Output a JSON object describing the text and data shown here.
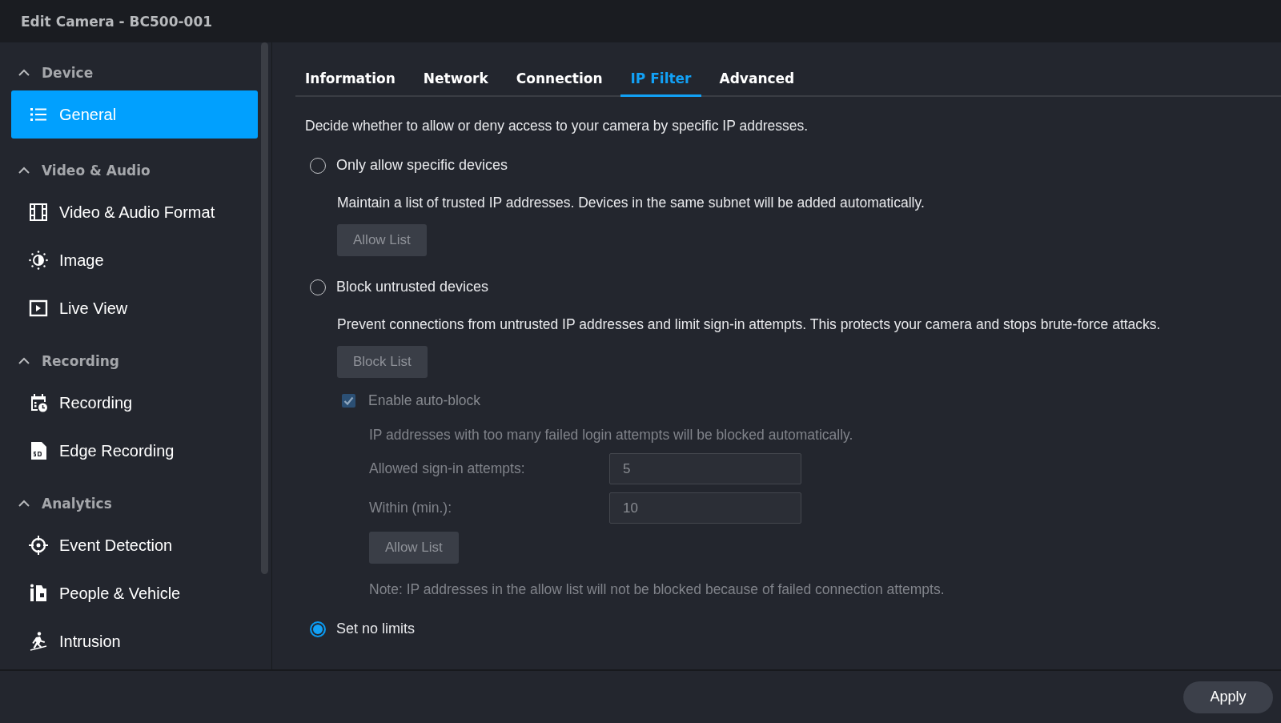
{
  "window": {
    "title": "Edit Camera - BC500-001"
  },
  "sidebar": {
    "groups": [
      {
        "label": "Device",
        "expanded": true,
        "items": [
          {
            "label": "General",
            "selected": true
          }
        ]
      },
      {
        "label": "Video & Audio",
        "expanded": true,
        "items": [
          {
            "label": "Video & Audio Format",
            "selected": false
          },
          {
            "label": "Image",
            "selected": false
          },
          {
            "label": "Live View",
            "selected": false
          }
        ]
      },
      {
        "label": "Recording",
        "expanded": true,
        "items": [
          {
            "label": "Recording",
            "selected": false
          },
          {
            "label": "Edge Recording",
            "selected": false
          }
        ]
      },
      {
        "label": "Analytics",
        "expanded": true,
        "items": [
          {
            "label": "Event Detection",
            "selected": false
          },
          {
            "label": "People & Vehicle",
            "selected": false
          },
          {
            "label": "Intrusion",
            "selected": false
          }
        ]
      }
    ]
  },
  "tabs": [
    {
      "label": "Information",
      "selected": false
    },
    {
      "label": "Network",
      "selected": false
    },
    {
      "label": "Connection",
      "selected": false
    },
    {
      "label": "IP Filter",
      "selected": true
    },
    {
      "label": "Advanced",
      "selected": false
    }
  ],
  "content": {
    "intro": "Decide whether to allow or deny access to your camera by specific IP addresses.",
    "options": [
      {
        "label": "Only allow specific devices",
        "selected": false,
        "description": "Maintain a list of trusted IP addresses. Devices in the same subnet will be added automatically.",
        "button": "Allow List"
      },
      {
        "label": "Block untrusted devices",
        "selected": false,
        "description": "Prevent connections from untrusted IP addresses and limit sign-in attempts. This protects your camera and stops brute-force attacks.",
        "button": "Block List",
        "auto_block": {
          "label": "Enable auto-block",
          "checked": true,
          "disabled": true,
          "description": "IP addresses with too many failed login attempts will be blocked automatically.",
          "fields": [
            {
              "label": "Allowed sign-in attempts:",
              "value": "5"
            },
            {
              "label": "Within (min.):",
              "value": "10"
            }
          ],
          "button": "Allow List",
          "note": "Note: IP addresses in the allow list will not be blocked because of failed connection attempts."
        }
      },
      {
        "label": "Set no limits",
        "selected": true
      }
    ]
  },
  "footer": {
    "apply": "Apply"
  }
}
